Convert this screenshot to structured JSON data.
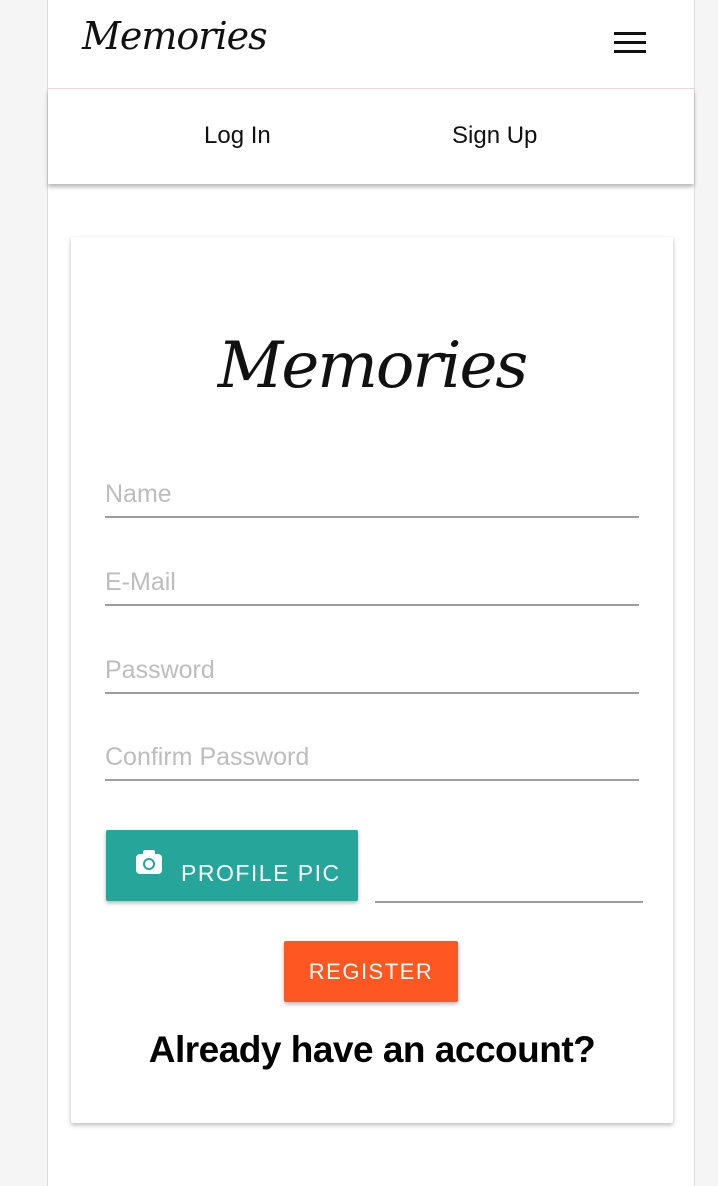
{
  "navbar": {
    "brand": "Memories",
    "menu_icon": "hamburger-menu-icon"
  },
  "subnav": {
    "login": "Log In",
    "signup": "Sign Up"
  },
  "form": {
    "logo": "Memories",
    "name_placeholder": "Name",
    "email_placeholder": "E-Mail",
    "password_placeholder": "Password",
    "confirm_placeholder": "Confirm Password",
    "profile_pic_label": "PROFILE PIC",
    "profile_pic_icon": "camera-icon",
    "register_label": "REGISTER",
    "already_account": "Already have an account?"
  },
  "colors": {
    "profile_button": "#26a69a",
    "register_button": "#ff5722"
  }
}
